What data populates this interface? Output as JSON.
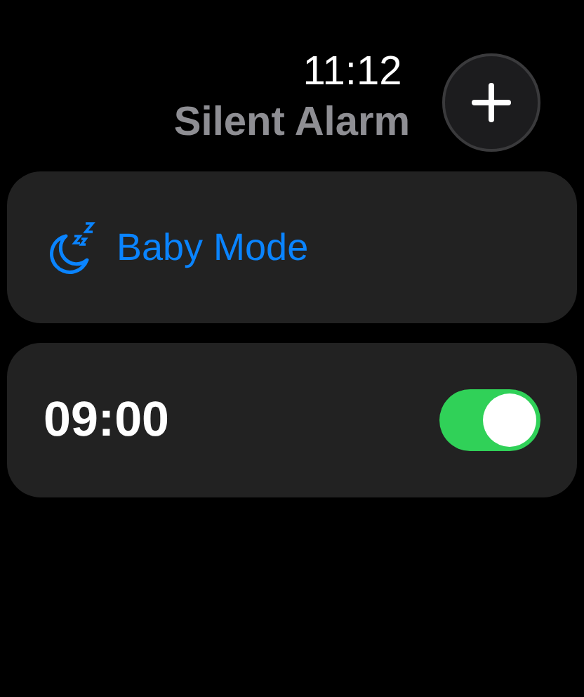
{
  "status_bar": {
    "time": "11:12"
  },
  "header": {
    "title": "Silent Alarm"
  },
  "mode_card": {
    "label": "Baby Mode"
  },
  "alarms": [
    {
      "time": "09:00",
      "on": true
    }
  ]
}
